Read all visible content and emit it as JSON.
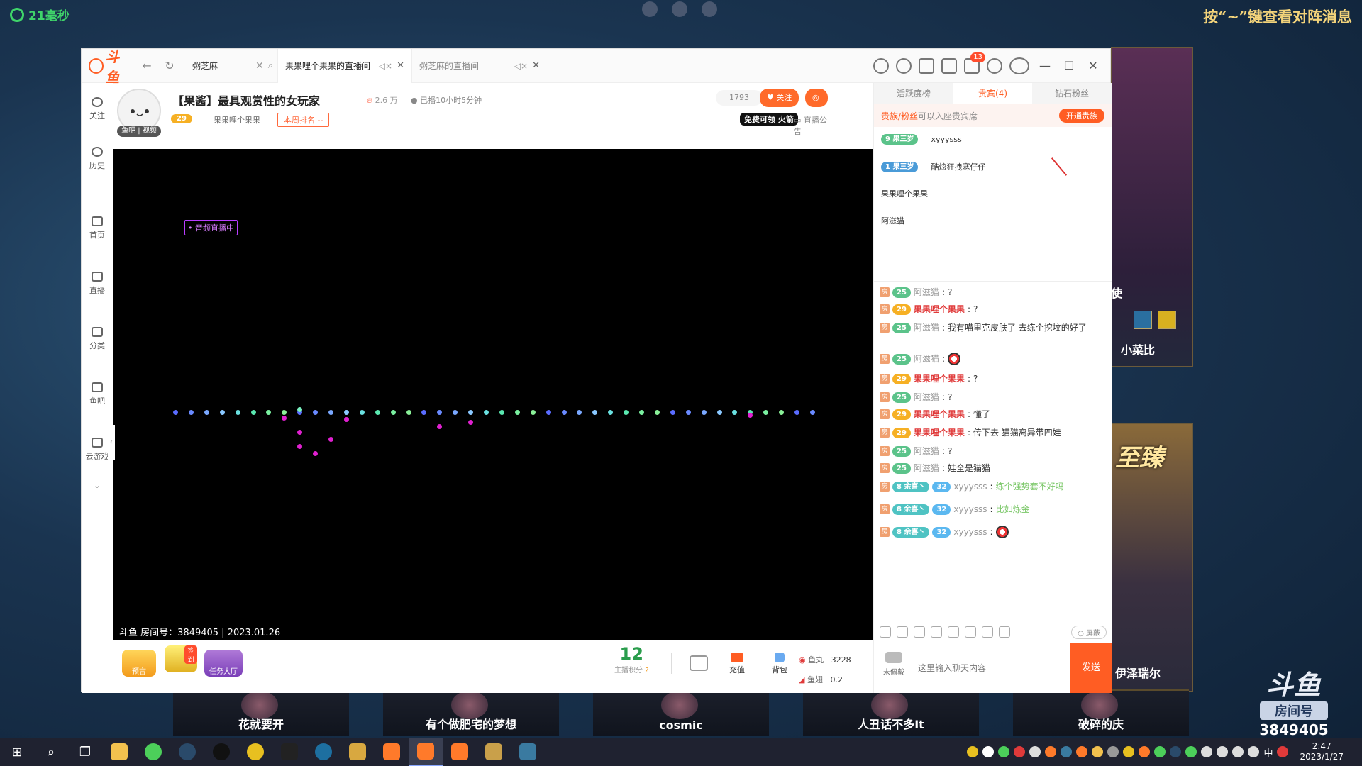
{
  "game": {
    "ping_label": "21毫秒",
    "hint": "按“~”键查看对阵消息",
    "right_top_name": "小菜比",
    "right_top_tag": "使",
    "right_bottom_name": "伊泽瑞尔",
    "right_bottom_title": "至臻",
    "players": [
      "花就要开",
      "有个做肥宅的梦想",
      "cosmic",
      "人丑话不多It",
      "破碎的庆"
    ],
    "watermark": {
      "logo": "斗鱼",
      "sub": "房间号",
      "room_id": "3849405"
    }
  },
  "window": {
    "logo_text": "斗鱼",
    "search_value": "粥芝麻",
    "tabs": [
      {
        "label": "果果哩个果果的直播间",
        "active": true
      },
      {
        "label": "粥芝麻的直播间",
        "active": false
      }
    ],
    "notif_count": "13",
    "nav": [
      "关注",
      "历史",
      "首页",
      "直播",
      "分类",
      "鱼吧",
      "云游戏"
    ]
  },
  "room": {
    "title": "【果酱】最具观赏性的女玩家",
    "hot": "2.6 万",
    "live_time": "已播10小时5分钟",
    "avatar_tag": "鱼吧 | 视频",
    "level": "29",
    "anchor": "果果哩个果果",
    "rank": "本周排名 --",
    "follow_count": "1793",
    "follow_btn": "关注",
    "gamebar_btn": "游戏吧",
    "free_badge": "免费可领 火箭",
    "notice": "直播公告"
  },
  "player": {
    "audio_tag": "• 音频直播中",
    "footer": "斗鱼 房间号：3849405 | 2023.01.26"
  },
  "bottom_bar": {
    "yuyan": "预言",
    "signin": "签到",
    "task_hall": "任务大厅",
    "score_value": "12",
    "score_label": "主播积分",
    "recharge": "充值",
    "bag": "背包",
    "yuwan_label": "鱼丸",
    "yuwan_value": "3228",
    "yuchi_label": "鱼翅",
    "yuchi_value": "0.2"
  },
  "side": {
    "tabs": [
      "活跃度榜",
      "贵宾(4)",
      "钻石粉丝"
    ],
    "vip_bar_hl": "贵族/粉丝",
    "vip_bar_text": "可以入座贵宾席",
    "vip_open_btn": "开通贵族",
    "vip_list": [
      {
        "badge": "9 果三岁",
        "name": "xyyysss"
      },
      {
        "badge": "1 果三岁",
        "name": "酷炫狂拽寒仔仔"
      },
      {
        "badge": "",
        "name": "果果哩个果果"
      },
      {
        "badge": "",
        "name": "阿滋猫"
      }
    ],
    "chat": [
      {
        "lv": "25",
        "user": "阿滋猫",
        "text": "?",
        "red": false
      },
      {
        "lv": "29",
        "user": "果果哩个果果",
        "text": "?",
        "red": true
      },
      {
        "lv": "25",
        "user": "阿滋猫",
        "text": "我有喵里克皮肤了 去练个挖坟的好了",
        "red": false
      },
      {
        "lv": "25",
        "user": "阿滋猫",
        "text": "",
        "red": false,
        "emote": true
      },
      {
        "lv": "29",
        "user": "果果哩个果果",
        "text": "?",
        "red": true
      },
      {
        "lv": "25",
        "user": "阿滋猫",
        "text": "?",
        "red": false
      },
      {
        "lv": "29",
        "user": "果果哩个果果",
        "text": "懂了",
        "red": true
      },
      {
        "lv": "29",
        "user": "果果哩个果果",
        "text": "传下去 猫猫离异带四娃",
        "red": true
      },
      {
        "lv": "25",
        "user": "阿滋猫",
        "text": "?",
        "red": false
      },
      {
        "lv": "25",
        "user": "阿滋猫",
        "text": "娃全是猫猫",
        "red": false
      },
      {
        "lv": "32",
        "user": "xyyysss",
        "text": "练个强势套不好吗",
        "red": false,
        "fan": "8 余喜丶",
        "green": true
      },
      {
        "lv": "32",
        "user": "xyyysss",
        "text": "比如炼金",
        "red": false,
        "fan": "8 余喜丶",
        "green": true
      },
      {
        "lv": "32",
        "user": "xyyysss",
        "text": "",
        "red": false,
        "fan": "8 余喜丶",
        "emote": true
      }
    ],
    "shield": "屏蔽",
    "not_worn": "未佩戴",
    "input_placeholder": "这里输入聊天内容",
    "send": "发送"
  },
  "taskbar": {
    "time": "2:47",
    "date": "2023/1/27",
    "ime": "中"
  }
}
